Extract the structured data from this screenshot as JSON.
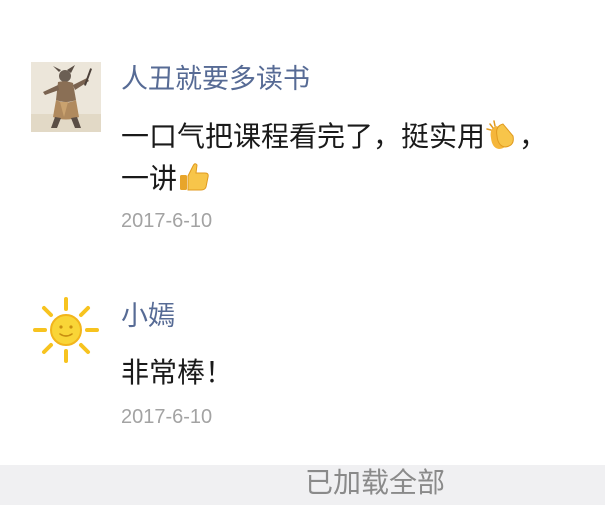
{
  "comments": [
    {
      "author": "人丑就要多读书",
      "avatar_icon": "samurai-avatar-icon",
      "content_line1": "一口气把课程看完了，挺实用",
      "content_line1_emoji": "clapping-hands-icon",
      "content_line1_tail": "，",
      "content_line2": "一讲",
      "content_line2_emoji": "thumbs-up-icon",
      "date": "2017-6-10"
    },
    {
      "author": "小嫣",
      "avatar_icon": "sun-avatar-icon",
      "content": "非常棒！",
      "date": "2017-6-10"
    }
  ],
  "footer": {
    "label": "已加载全部"
  },
  "colors": {
    "author_link": "#576b95",
    "date_gray": "#a3a3a3",
    "footer_bg": "#f0f0f2"
  }
}
